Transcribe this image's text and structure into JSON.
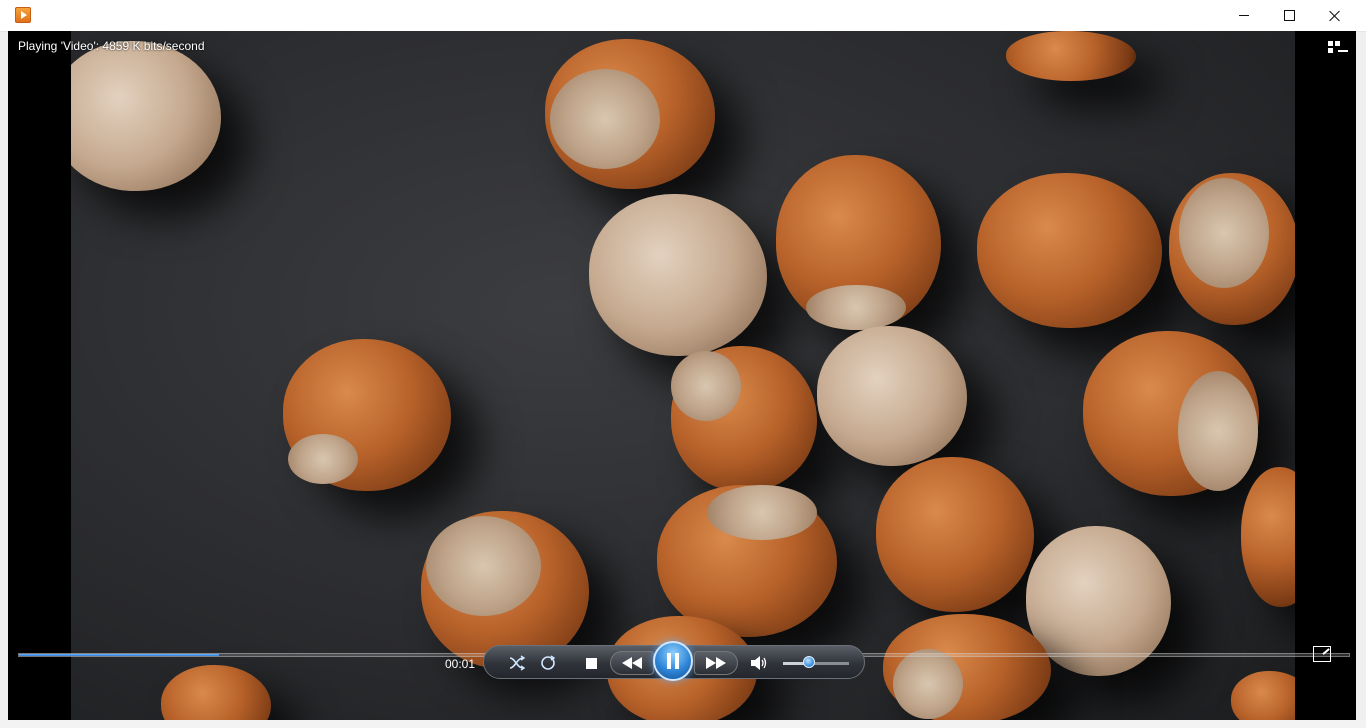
{
  "window": {
    "app_icon": "media-player-icon",
    "minimize_icon": "minimize-icon",
    "maximize_icon": "maximize-icon",
    "close_icon": "close-icon"
  },
  "player": {
    "status_text": "Playing 'Video': 4859 K bits/second",
    "switch_library_icon": "switch-to-library-icon",
    "seek_progress_fraction": 0.15,
    "time_elapsed": "00:01",
    "volume_fraction": 0.45,
    "accent_color": "#2f86d6",
    "controls": {
      "shuffle_icon": "shuffle-icon",
      "repeat_icon": "repeat-icon",
      "stop_icon": "stop-icon",
      "previous_icon": "previous-icon",
      "play_pause_icon": "pause-icon",
      "next_icon": "next-icon",
      "mute_icon": "speaker-icon",
      "fullscreen_icon": "fullscreen-icon"
    }
  }
}
